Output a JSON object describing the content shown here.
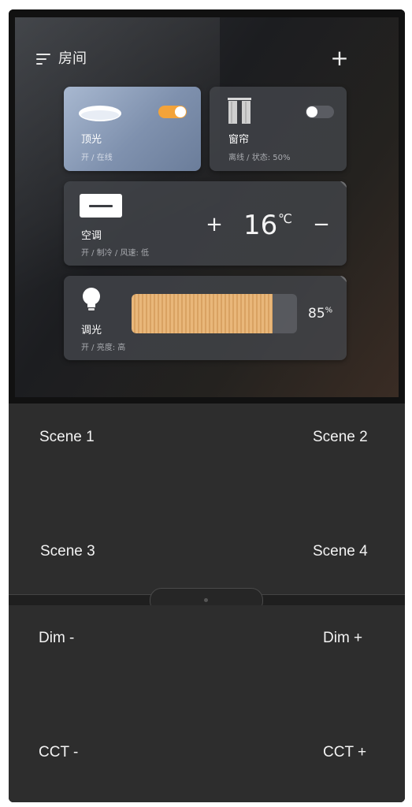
{
  "header": {
    "title": "房间",
    "menu_icon": "menu-icon",
    "add_icon": "plus-icon"
  },
  "devices": {
    "ceiling_light": {
      "name": "顶光",
      "status": "开 / 在线",
      "icon": "ceiling-light-icon",
      "toggle_on": true,
      "toggle_color": "#f3a33a"
    },
    "curtain": {
      "name": "窗帘",
      "status": "离线 / 状态: 50%",
      "icon": "curtain-icon",
      "toggle_on": false
    },
    "air_conditioner": {
      "name": "空调",
      "status": "开 / 制冷 / 风速: 低",
      "icon": "air-conditioner-icon",
      "temperature": "16",
      "unit": "℃",
      "increase_label": "+",
      "decrease_label": "−"
    },
    "dimmer": {
      "name": "调光",
      "status": "开 / 亮度: 高",
      "icon": "bulb-icon",
      "brightness": "85",
      "unit": "%",
      "brightness_fraction": 0.85
    }
  },
  "keys": {
    "scene1": "Scene 1",
    "scene2": "Scene 2",
    "scene3": "Scene 3",
    "scene4": "Scene 4",
    "dim_minus": "Dim -",
    "dim_plus": "Dim +",
    "cct_minus": "CCT -",
    "cct_plus": "CCT +"
  },
  "colors": {
    "accent": "#f3a33a",
    "panel": "#2d2d2d",
    "slider_fill": "#e9b77a"
  }
}
